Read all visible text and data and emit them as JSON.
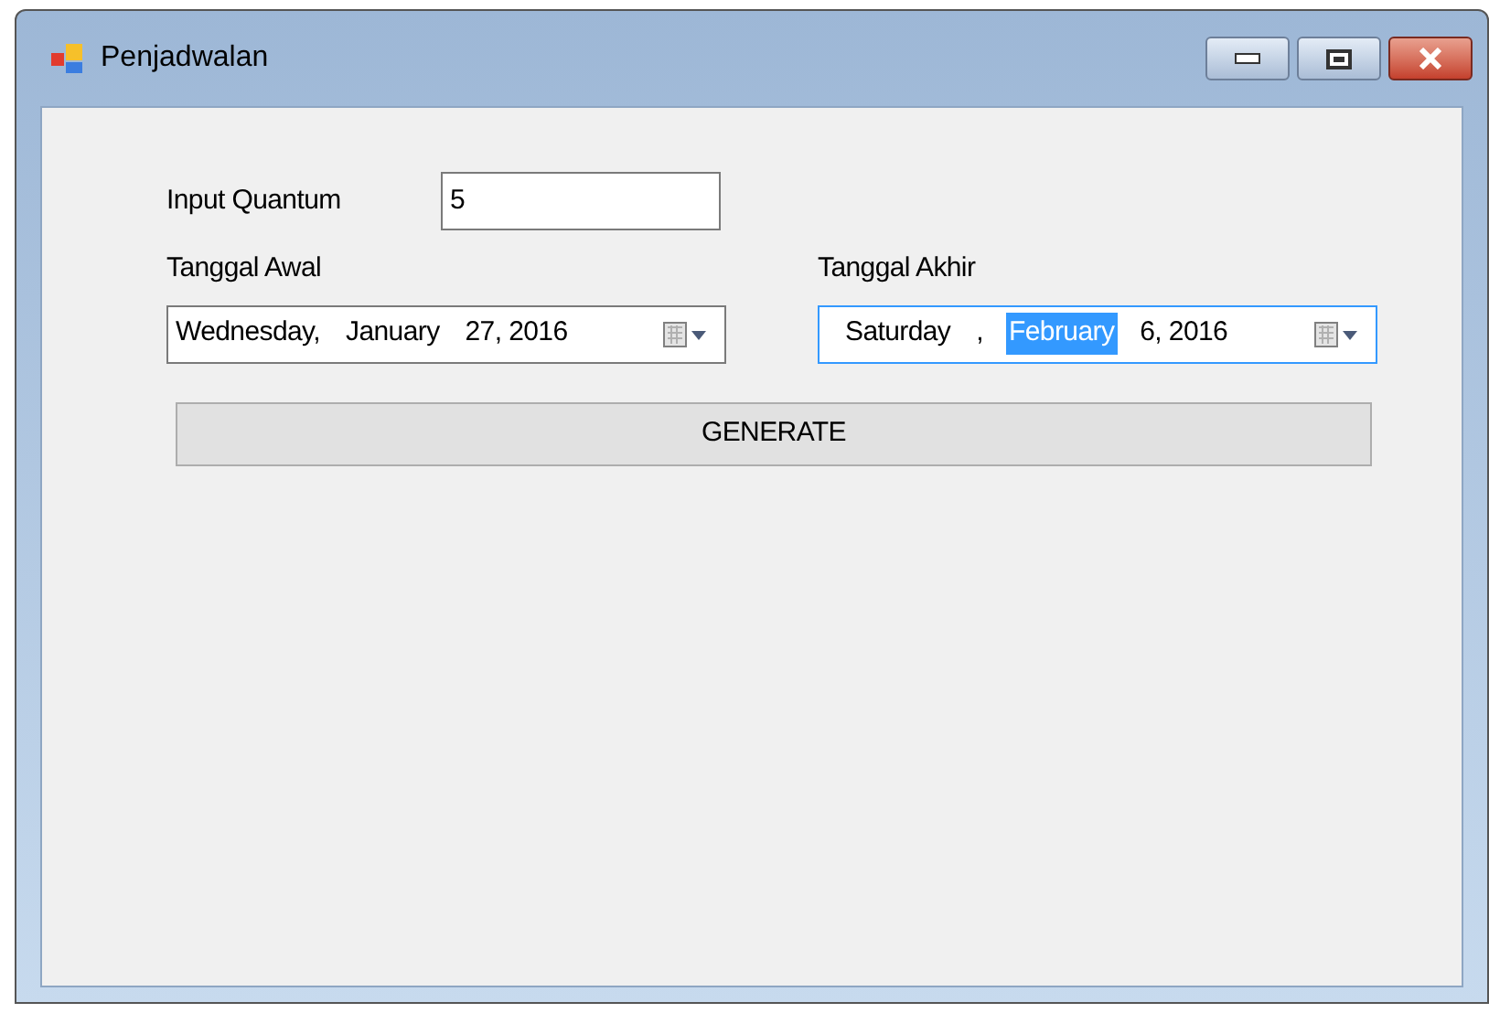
{
  "window": {
    "title": "Penjadwalan"
  },
  "quantum": {
    "label": "Input Quantum",
    "value": "5"
  },
  "start_date": {
    "label": "Tanggal Awal",
    "focused": false,
    "segments": [
      {
        "text": "Wednesday,",
        "selected": false
      },
      {
        "text": "January",
        "selected": false
      },
      {
        "text": "27, 2016",
        "selected": false
      }
    ]
  },
  "end_date": {
    "label": "Tanggal Akhir",
    "focused": true,
    "segments": [
      {
        "text": "Saturday",
        "selected": false
      },
      {
        "text": ",",
        "selected": false
      },
      {
        "text": "February",
        "selected": true
      },
      {
        "text": "6, 2016",
        "selected": false
      }
    ]
  },
  "generate_button": {
    "label": "GENERATE"
  }
}
